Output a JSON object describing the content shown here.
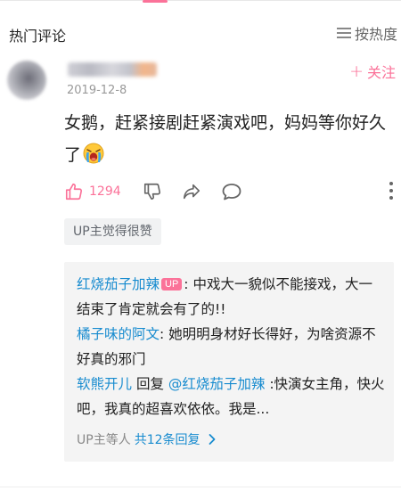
{
  "header": {
    "title": "热门评论",
    "sort_label": "按热度"
  },
  "comment": {
    "date": "2019-12-8",
    "follow_label": "关注",
    "text": "女鹅，赶紧接剧赶紧演戏吧，妈妈等你好久了",
    "emoji": "crying-emoji",
    "likes": "1294",
    "up_liked_label": "UP主觉得很赞"
  },
  "replies": [
    {
      "user": "红烧茄子加辣",
      "badge": "UP",
      "text": ": 中戏大一貌似不能接戏，大一结束了肯定就会有了的!!"
    },
    {
      "user": "橘子味的阿文",
      "text": ": 她明明身材好长得好，为啥资源不好真的邪门"
    },
    {
      "user": "软熊开儿",
      "reply_word": " 回复 ",
      "mention": "@红烧茄子加辣",
      "text": " :快演女主角，快火吧，我真的超喜欢依依。我是..."
    }
  ],
  "reply_summary": {
    "prefix": "UP主等人",
    "count_label": "共12条回复"
  },
  "colors": {
    "accent": "#fb7299",
    "link": "#178bcf",
    "reply_bg": "#f4f4f4"
  }
}
